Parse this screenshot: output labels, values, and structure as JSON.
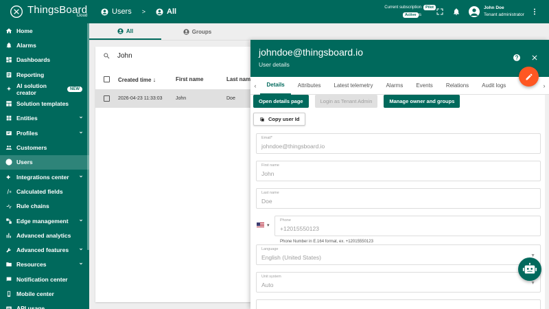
{
  "brand": {
    "name": "ThingsBoard",
    "sub": "Cloud"
  },
  "sidebar": {
    "items": [
      {
        "label": "Home",
        "icon": "home-icon",
        "chevron": false
      },
      {
        "label": "Alarms",
        "icon": "alarm-icon",
        "chevron": false
      },
      {
        "label": "Dashboards",
        "icon": "dashboard-icon",
        "chevron": false
      },
      {
        "label": "Reporting",
        "icon": "report-icon",
        "chevron": false
      },
      {
        "label": "AI solution creator",
        "icon": "ai-sparkle-icon",
        "chevron": false,
        "badge": "NEW"
      },
      {
        "label": "Solution templates",
        "icon": "template-icon",
        "chevron": false
      },
      {
        "label": "Entities",
        "icon": "entities-icon",
        "chevron": true
      },
      {
        "label": "Profiles",
        "icon": "profiles-icon",
        "chevron": true
      },
      {
        "label": "Customers",
        "icon": "customers-icon",
        "chevron": false
      },
      {
        "label": "Users",
        "icon": "users-icon",
        "chevron": false,
        "active": true
      },
      {
        "label": "Integrations center",
        "icon": "integrations-icon",
        "chevron": true
      },
      {
        "label": "Calculated fields",
        "icon": "function-icon",
        "chevron": false
      },
      {
        "label": "Rule chains",
        "icon": "rule-chain-icon",
        "chevron": false
      },
      {
        "label": "Edge management",
        "icon": "edge-icon",
        "chevron": true
      },
      {
        "label": "Advanced analytics",
        "icon": "analytics-icon",
        "chevron": false
      },
      {
        "label": "Advanced features",
        "icon": "tools-icon",
        "chevron": true
      },
      {
        "label": "Resources",
        "icon": "folder-icon",
        "chevron": true
      },
      {
        "label": "Notification center",
        "icon": "notification-icon",
        "chevron": false
      },
      {
        "label": "Mobile center",
        "icon": "mobile-icon",
        "chevron": false
      },
      {
        "label": "API usage",
        "icon": "api-icon",
        "chevron": false
      }
    ]
  },
  "topbar": {
    "crumb_users": "Users",
    "crumb_sep": ">",
    "crumb_all": "All",
    "subscription_label": "Current subscription",
    "subscription_value": "Pilot",
    "status_label": "Status",
    "status_value": "Active",
    "user_name": "John Doe",
    "user_role": "Tenant administrator"
  },
  "tabs": {
    "all": "All",
    "groups": "Groups"
  },
  "search": {
    "value": "John"
  },
  "table": {
    "headers": {
      "created": "Created time",
      "first": "First name",
      "last": "Last nam"
    },
    "rows": [
      {
        "created": "2026-04-23 11:33:03",
        "first": "John",
        "last": "Doe"
      }
    ]
  },
  "panel": {
    "title": "johndoe@thingsboard.io",
    "subtitle": "User details",
    "tabs": [
      "Details",
      "Attributes",
      "Latest telemetry",
      "Alarms",
      "Events",
      "Relations",
      "Audit logs"
    ],
    "buttons": {
      "open_details": "Open details page",
      "login_as": "Login as Tenant Admin",
      "manage_owner": "Manage owner and groups",
      "copy_id": "Copy user Id"
    },
    "fields": {
      "email_label": "Email*",
      "email_value": "johndoe@thingsboard.io",
      "first_label": "First name",
      "first_value": "John",
      "last_label": "Last name",
      "last_value": "Doe",
      "phone_label": "Phone",
      "phone_value": "+12015550123",
      "phone_hint": "Phone Number in E.164 format, ex. +12015550123",
      "language_label": "Language",
      "language_value": "English (United States)",
      "unit_label": "Unit system",
      "unit_value": "Auto"
    }
  },
  "colors": {
    "primary": "#00695c",
    "fab": "#ff5722"
  }
}
